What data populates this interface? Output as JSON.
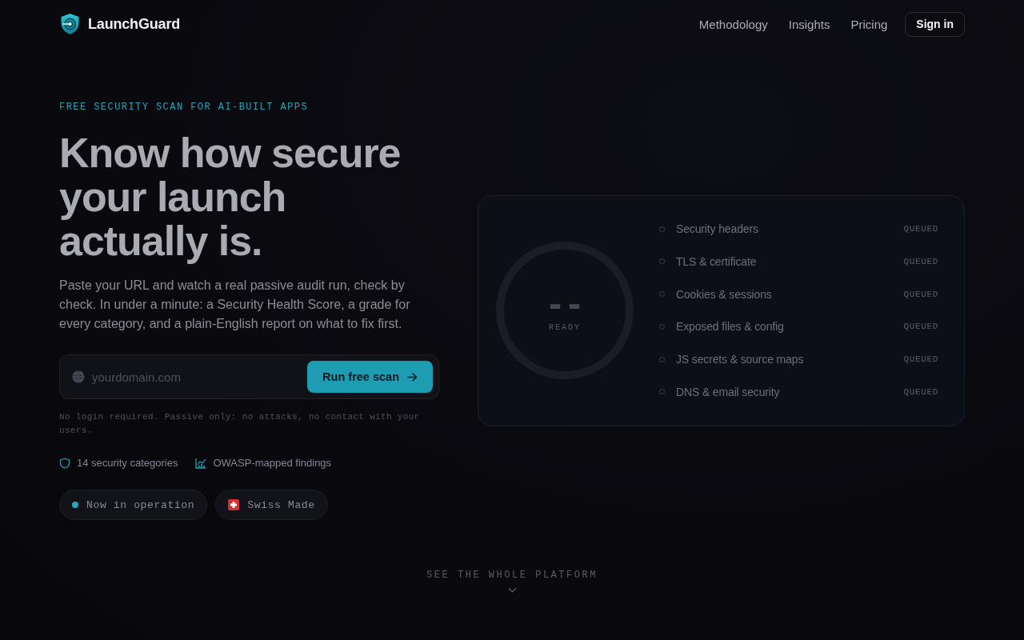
{
  "brand": {
    "name": "LaunchGuard"
  },
  "nav": {
    "links": [
      {
        "label": "Methodology"
      },
      {
        "label": "Insights"
      },
      {
        "label": "Pricing"
      }
    ],
    "sign_in": "Sign in"
  },
  "hero": {
    "eyebrow": "FREE SECURITY SCAN FOR AI-BUILT APPS",
    "headline": "Know how secure your launch actually is.",
    "lead": "Paste your URL and watch a real passive audit run, check by check. In under a minute: a Security Health Score, a grade for every category, and a plain-English report on what to fix first.",
    "scan_form": {
      "placeholder": "yourdomain.com",
      "button": "Run free scan"
    },
    "hint": "No login required. Passive only: no attacks, no contact with your users.",
    "features": [
      {
        "kind": "categories",
        "label": "14 security categories"
      },
      {
        "kind": "owasp",
        "label": "OWASP-mapped findings"
      }
    ],
    "badges": [
      {
        "kind": "status",
        "label": "Now in operation"
      },
      {
        "kind": "swiss",
        "label": "Swiss Made"
      }
    ]
  },
  "scan_preview": {
    "score": "--",
    "score_label": "READY",
    "checks": [
      {
        "label": "Security headers",
        "status": "QUEUED"
      },
      {
        "label": "TLS & certificate",
        "status": "QUEUED"
      },
      {
        "label": "Cookies & sessions",
        "status": "QUEUED"
      },
      {
        "label": "Exposed files & config",
        "status": "QUEUED"
      },
      {
        "label": "JS secrets & source maps",
        "status": "QUEUED"
      },
      {
        "label": "DNS & email security",
        "status": "QUEUED"
      }
    ]
  },
  "more_link": {
    "label": "SEE THE WHOLE PLATFORM"
  }
}
